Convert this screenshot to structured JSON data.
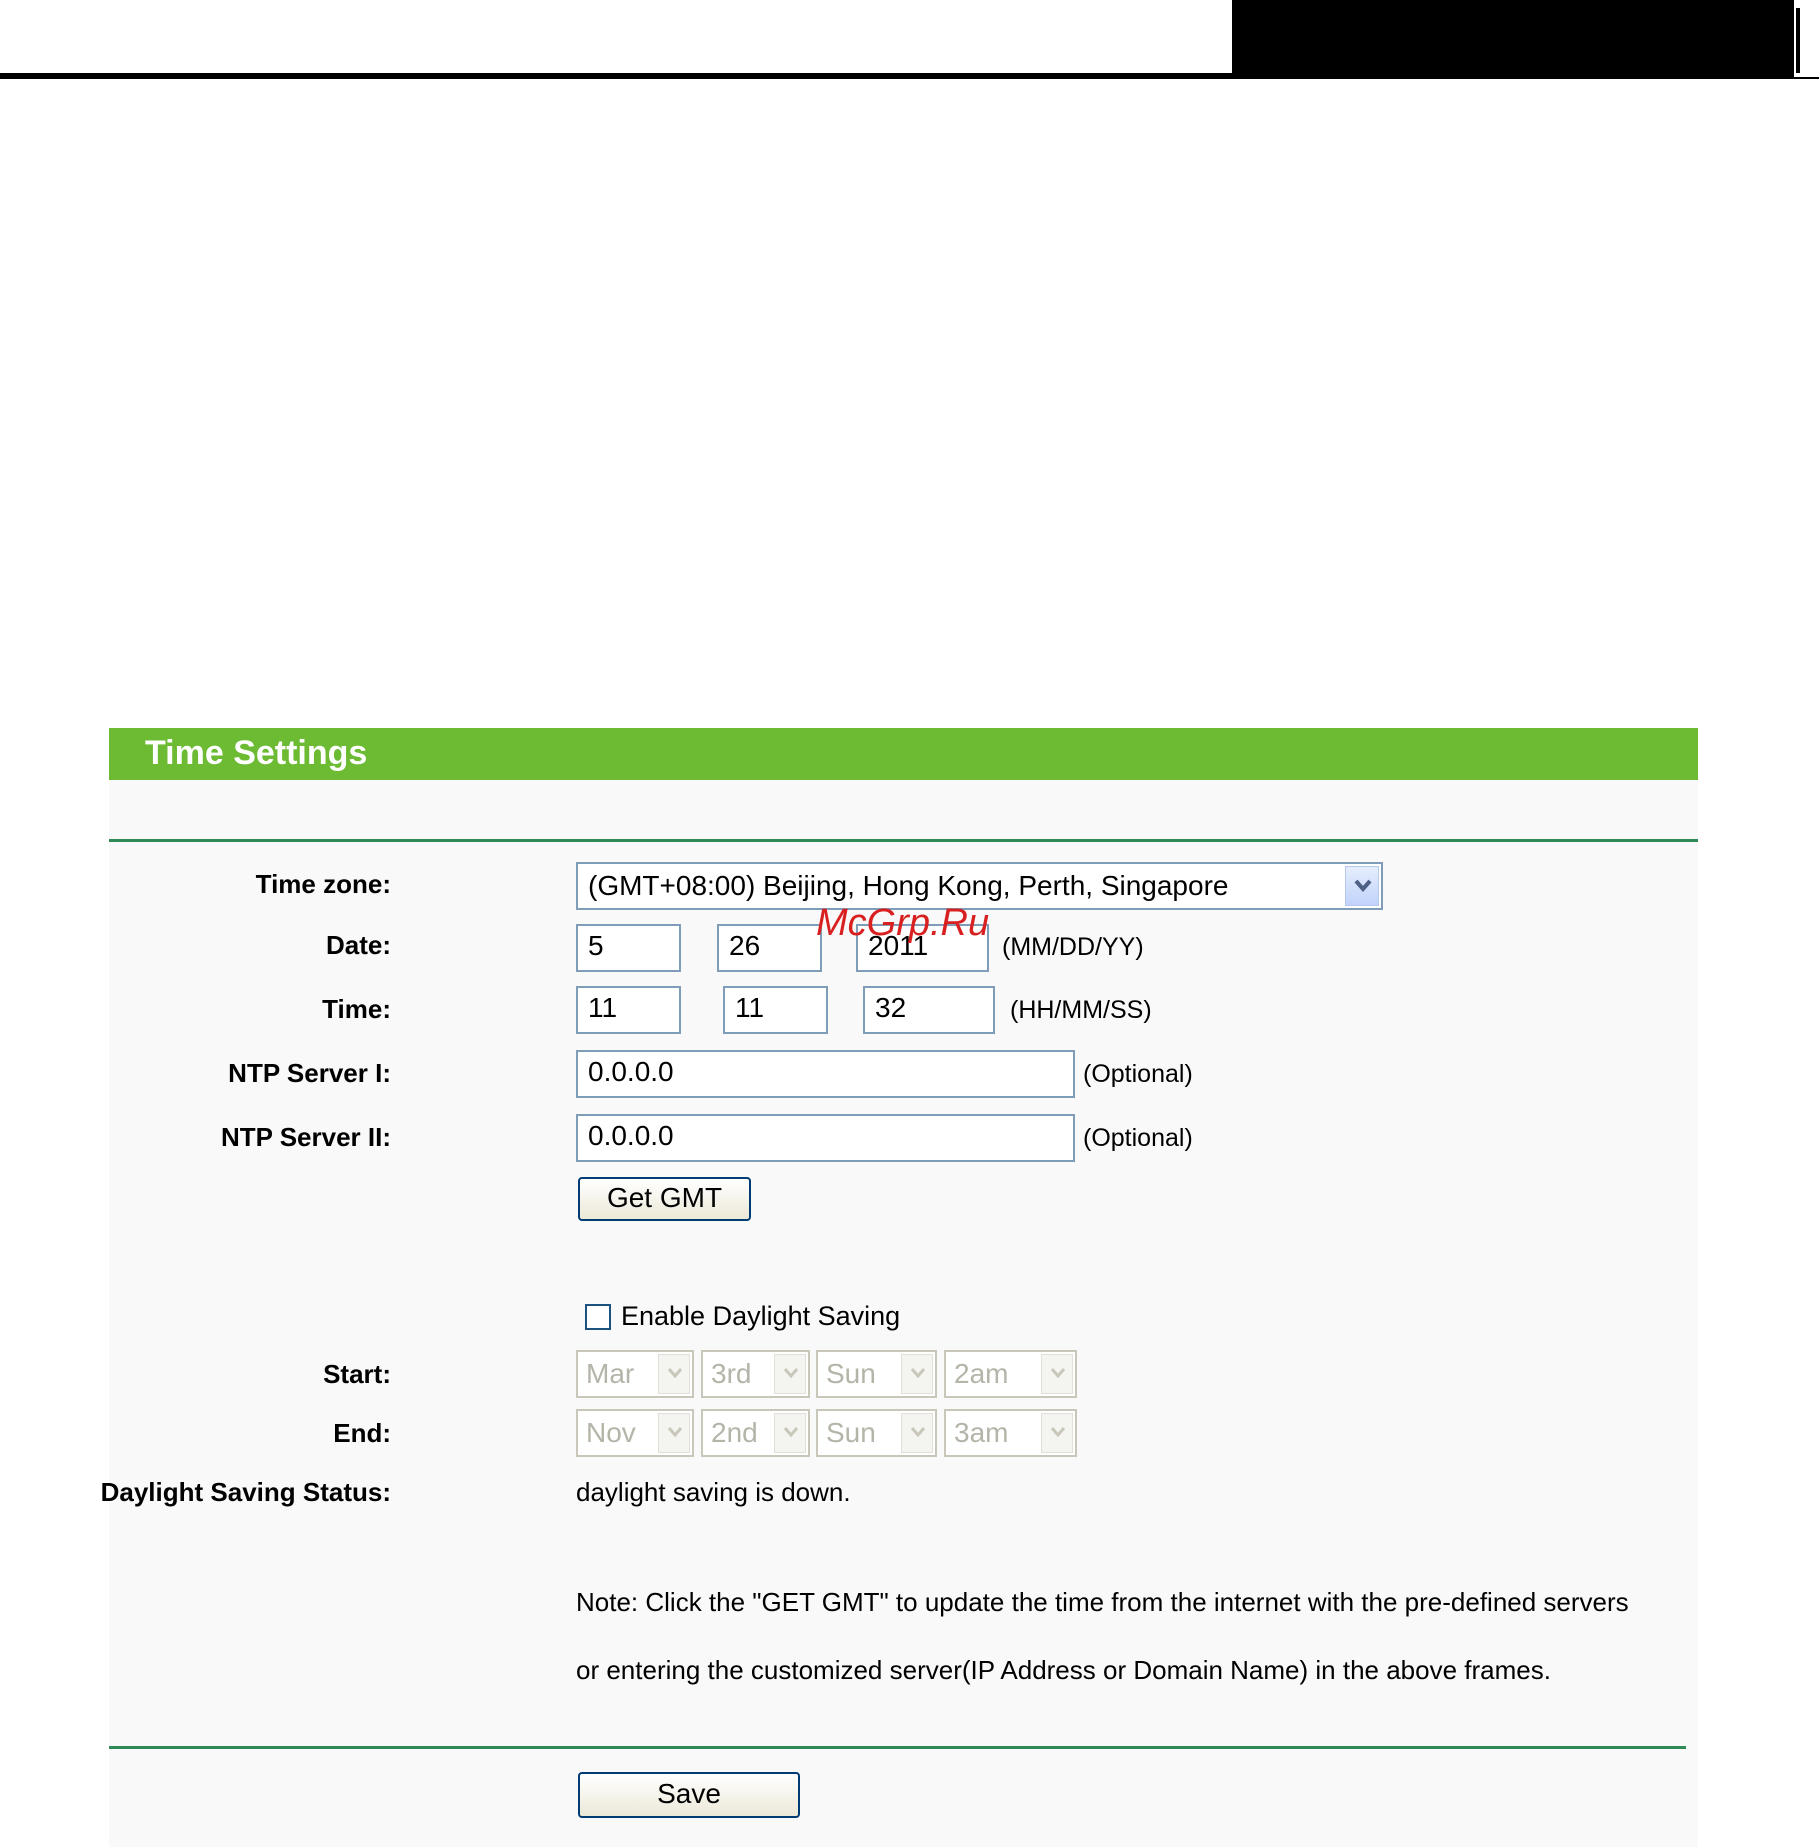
{
  "page": {
    "title": "Time Settings",
    "watermark": "McGrp.Ru"
  },
  "colors": {
    "title_bar": "#6cbb33",
    "rule": "#2e8b57"
  },
  "form": {
    "timezone": {
      "label": "Time zone:",
      "value": "(GMT+08:00) Beijing, Hong Kong, Perth, Singapore"
    },
    "date": {
      "label": "Date:",
      "month": "5",
      "day": "26",
      "year": "2011",
      "format": "(MM/DD/YY)"
    },
    "time": {
      "label": "Time:",
      "hour": "11",
      "minute": "11",
      "second": "32",
      "format": "(HH/MM/SS)"
    },
    "ntp1": {
      "label": "NTP Server I:",
      "value": "0.0.0.0",
      "hint": "(Optional)"
    },
    "ntp2": {
      "label": "NTP Server II:",
      "value": "0.0.0.0",
      "hint": "(Optional)"
    },
    "get_gmt_label": "Get GMT",
    "dst_enable_label": "Enable Daylight Saving",
    "dst_enabled": false,
    "start": {
      "label": "Start:",
      "month": "Mar",
      "week": "3rd",
      "day": "Sun",
      "hour": "2am"
    },
    "end": {
      "label": "End:",
      "month": "Nov",
      "week": "2nd",
      "day": "Sun",
      "hour": "3am"
    },
    "status": {
      "label": "Daylight Saving Status:",
      "value": "daylight saving is down."
    },
    "note_line1": "Note: Click the \"GET GMT\" to update the time from the internet with the pre-defined servers",
    "note_line2": "or entering the customized server(IP Address or Domain Name) in the above frames.",
    "save_label": "Save"
  }
}
